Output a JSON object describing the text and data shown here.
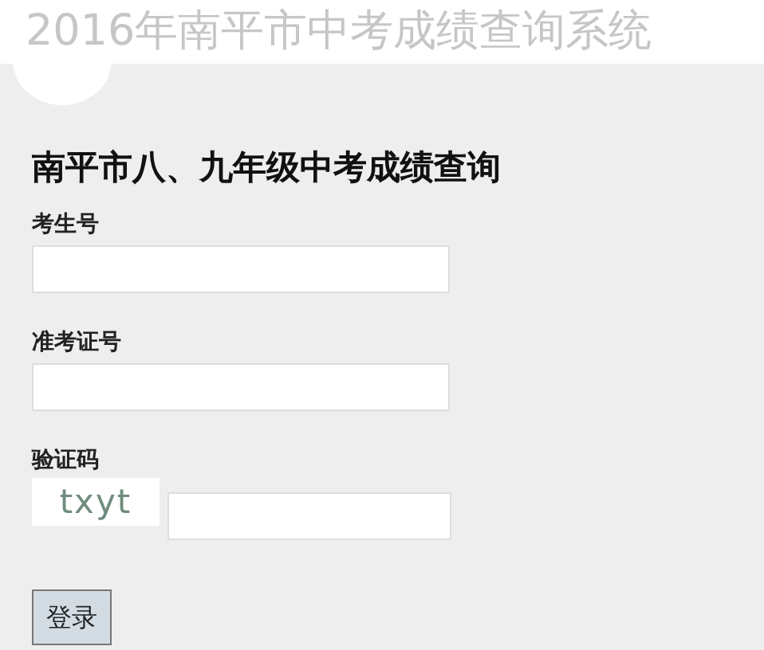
{
  "banner": {
    "title": "2016年南平市中考成绩查询系统"
  },
  "form": {
    "heading": "南平市八、九年级中考成绩查询",
    "fields": [
      {
        "kind": "text",
        "label": "考生号"
      },
      {
        "kind": "text",
        "label": "准考证号"
      },
      {
        "kind": "captcha",
        "label": "验证码",
        "captcha": "txyt"
      }
    ],
    "submit": "登录"
  }
}
